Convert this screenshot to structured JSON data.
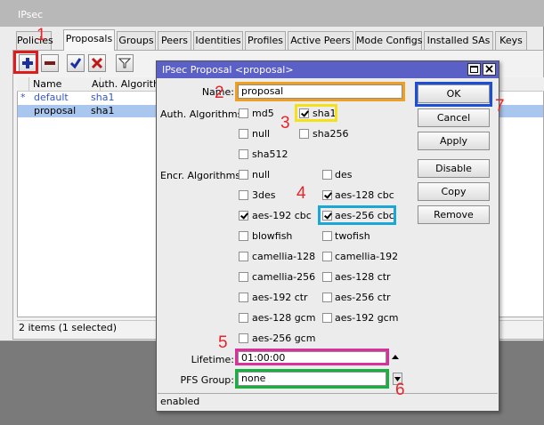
{
  "main_window": {
    "title": "IPsec",
    "tabs": [
      {
        "label": "Policies"
      },
      {
        "label": "Proposals"
      },
      {
        "label": "Groups"
      },
      {
        "label": "Peers"
      },
      {
        "label": "Identities"
      },
      {
        "label": "Profiles"
      },
      {
        "label": "Active Peers"
      },
      {
        "label": "Mode Configs"
      },
      {
        "label": "Installed SAs"
      },
      {
        "label": "Keys"
      }
    ],
    "active_tab": "Proposals",
    "toolbar": {
      "add_icon": "plus-icon",
      "remove_icon": "minus-icon",
      "enable_icon": "check-icon",
      "disable_icon": "cross-icon",
      "filter_icon": "funnel-icon"
    },
    "table": {
      "columns": [
        "Name",
        "Auth. Algorithms"
      ],
      "rows": [
        {
          "marker": "*",
          "name": "default",
          "auth": "sha1",
          "selected": false
        },
        {
          "marker": "",
          "name": "proposal",
          "auth": "sha1",
          "selected": true
        }
      ]
    },
    "status": "2 items (1 selected)"
  },
  "dialog": {
    "title": "IPsec Proposal <proposal>",
    "name_label": "Name:",
    "name_value": "proposal",
    "auth_label": "Auth. Algorithms:",
    "auth_algorithms": [
      {
        "label": "md5",
        "checked": false
      },
      {
        "label": "sha1",
        "checked": true
      },
      {
        "label": "null",
        "checked": false
      },
      {
        "label": "sha256",
        "checked": false
      },
      {
        "label": "sha512",
        "checked": false
      }
    ],
    "encr_label": "Encr. Algorithms:",
    "encr_algorithms": [
      {
        "label": "null",
        "checked": false
      },
      {
        "label": "des",
        "checked": false
      },
      {
        "label": "3des",
        "checked": false
      },
      {
        "label": "aes-128 cbc",
        "checked": true
      },
      {
        "label": "aes-192 cbc",
        "checked": true
      },
      {
        "label": "aes-256 cbc",
        "checked": true
      },
      {
        "label": "blowfish",
        "checked": false
      },
      {
        "label": "twofish",
        "checked": false
      },
      {
        "label": "camellia-128",
        "checked": false
      },
      {
        "label": "camellia-192",
        "checked": false
      },
      {
        "label": "camellia-256",
        "checked": false
      },
      {
        "label": "aes-128 ctr",
        "checked": false
      },
      {
        "label": "aes-192 ctr",
        "checked": false
      },
      {
        "label": "aes-256 ctr",
        "checked": false
      },
      {
        "label": "aes-128 gcm",
        "checked": false
      },
      {
        "label": "aes-192 gcm",
        "checked": false
      },
      {
        "label": "aes-256 gcm",
        "checked": false
      }
    ],
    "lifetime_label": "Lifetime:",
    "lifetime_value": "01:00:00",
    "pfs_label": "PFS Group:",
    "pfs_value": "none",
    "buttons": {
      "ok": "OK",
      "cancel": "Cancel",
      "apply": "Apply",
      "disable": "Disable",
      "copy": "Copy",
      "remove": "Remove"
    },
    "status": "enabled"
  },
  "annotations": [
    "1",
    "2",
    "3",
    "4",
    "5",
    "6",
    "7"
  ],
  "annotation_colors": {
    "text": "#e8242a",
    "add_button": "#e01b1b",
    "name": "#f0a020",
    "auth_sha1": "#f5e11a",
    "encr_aes256": "#1aa7d6",
    "lifetime": "#d9309b",
    "pfs": "#17b13f",
    "ok": "#1c4fd6"
  }
}
